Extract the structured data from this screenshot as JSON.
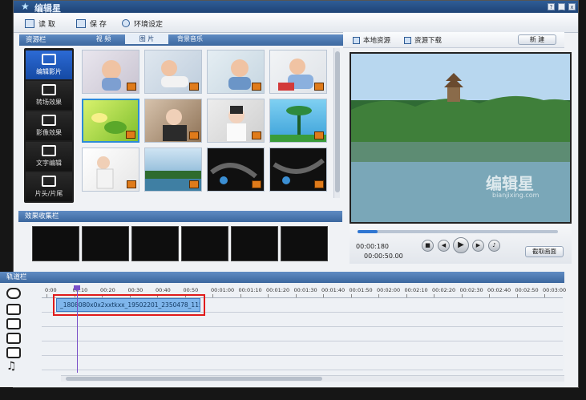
{
  "app": {
    "title": "编辑星"
  },
  "toolbar": {
    "read": "读 取",
    "save": "保 存",
    "settings": "环境设定"
  },
  "resource_panel": {
    "title": "资源栏",
    "tabs": [
      "视 频",
      "图 片",
      "背景音乐"
    ],
    "active_tab": 1
  },
  "sidebar": {
    "items": [
      "编辑影片",
      "转场效果",
      "影像效果",
      "文字编辑",
      "片头/片尾"
    ],
    "active": 0
  },
  "effects_panel": {
    "title": "效果收集栏"
  },
  "right_panel": {
    "local_resources": "本地资源",
    "resource_download": "资源下载",
    "new_button": "新 建",
    "watermark": "编辑星",
    "watermark_url": "bianjixing.com"
  },
  "player": {
    "time_current": "00:00:180",
    "time_total": "00:00:50.00",
    "progress": 0.1,
    "screenshot_button": "截取画面"
  },
  "track_panel": {
    "title": "轨道栏",
    "ruler_labels": [
      "0:00",
      "00:10",
      "00:20",
      "00:30",
      "00:40",
      "00:50",
      "00:01:00",
      "00:01:10",
      "00:01:20",
      "00:01:30",
      "00:01:40",
      "00:01:50",
      "00:02:00",
      "00:02:10",
      "00:02:20",
      "00:02:30",
      "00:02:40",
      "00:02:50",
      "00:03:00"
    ],
    "clip_label": "_1808080x0x2xxtkxx_19502201_2350478_1154020"
  },
  "colors": {
    "accent": "#3b679e",
    "highlight": "#e01b1b",
    "playhead": "#7a50c8"
  }
}
